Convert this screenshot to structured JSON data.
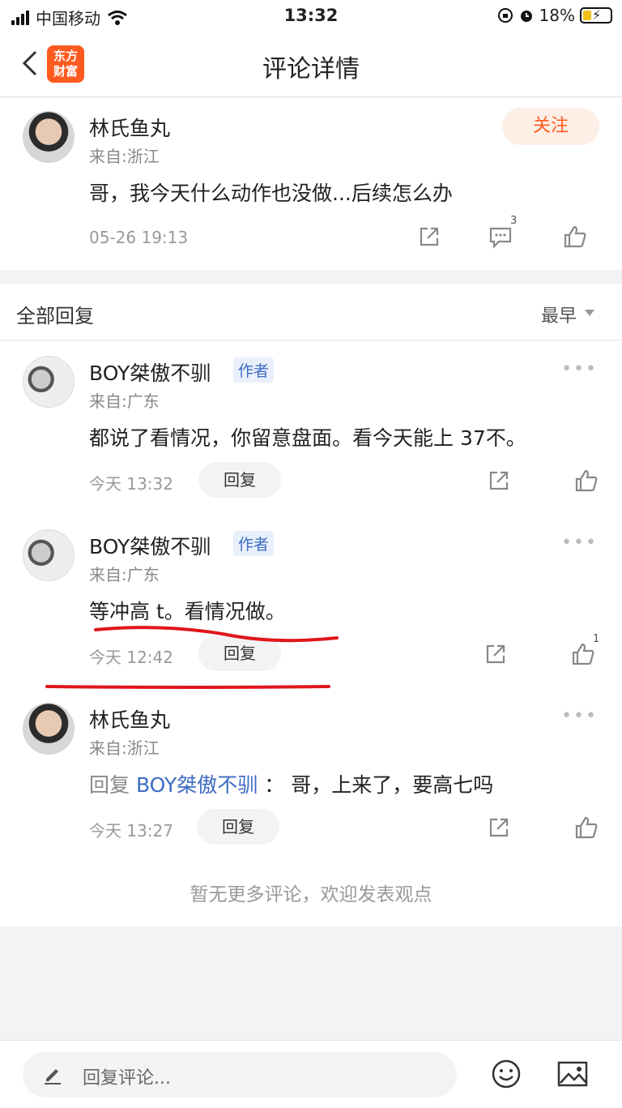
{
  "status_bar": {
    "carrier": "中国移动",
    "time": "13:32",
    "battery": "18%"
  },
  "nav": {
    "title": "评论详情",
    "logo_line1": "东方",
    "logo_line2": "财富"
  },
  "main_comment": {
    "user": "林氏鱼丸",
    "from": "来自:浙江",
    "follow": "关注",
    "text": "哥，我今天什么动作也没做...后续怎么办",
    "time": "05-26 19:13",
    "comment_count": "3"
  },
  "section": {
    "title": "全部回复",
    "sort": "最早"
  },
  "replies": [
    {
      "user": "BOY桀傲不驯",
      "tag": "作者",
      "from": "来自:广东",
      "text": "都说了看情况，你留意盘面。看今天能上 37不。",
      "time": "今天 13:32",
      "reply_label": "回复"
    },
    {
      "user": "BOY桀傲不驯",
      "tag": "作者",
      "from": "来自:广东",
      "text": "等冲高 t。看情况做。",
      "time": "今天 12:42",
      "reply_label": "回复",
      "like_count": "1"
    },
    {
      "user": "林氏鱼丸",
      "from": "来自:浙江",
      "reply_prefix": "回复",
      "reply_to": "BOY桀傲不驯",
      "sep": "：",
      "text": "哥，上来了，要高七吗",
      "time": "今天 13:27",
      "reply_label": "回复"
    }
  ],
  "no_more": "暂无更多评论，欢迎发表观点",
  "bottom_bar": {
    "placeholder": "回复评论..."
  }
}
